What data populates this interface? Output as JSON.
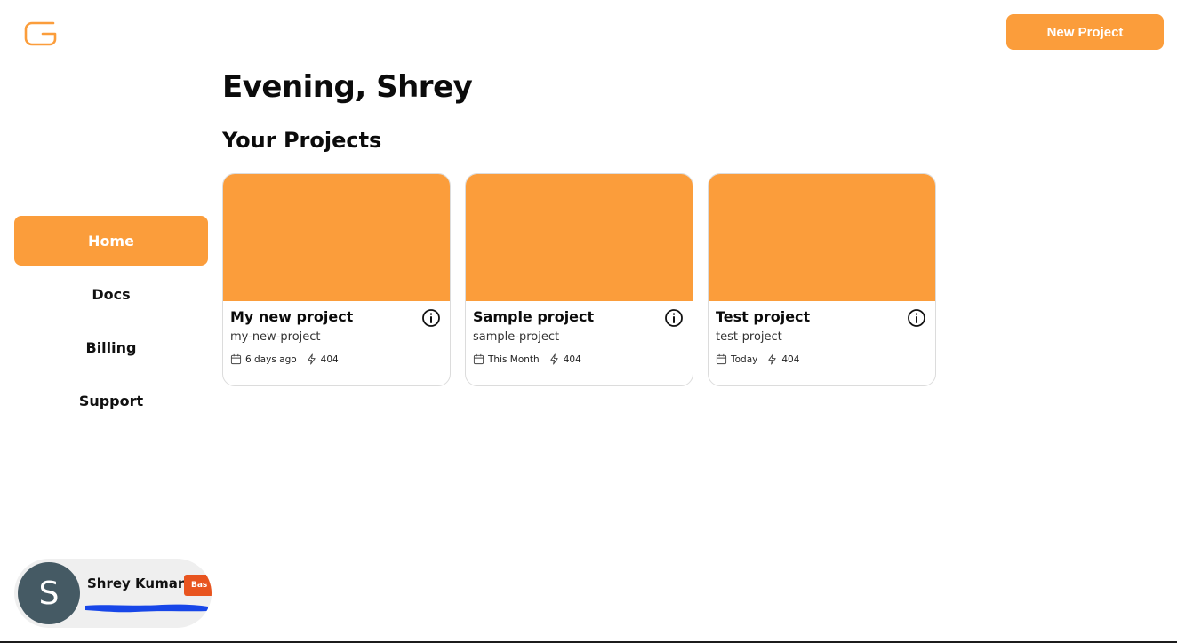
{
  "app": {
    "logo_icon": "g-logo-icon",
    "brand_color": "#fb9d3b"
  },
  "header": {
    "new_project_label": "New Project"
  },
  "sidebar": {
    "items": [
      {
        "label": "Home",
        "active": true
      },
      {
        "label": "Docs",
        "active": false
      },
      {
        "label": "Billing",
        "active": false
      },
      {
        "label": "Support",
        "active": false
      }
    ]
  },
  "user": {
    "avatar_initial": "S",
    "name": "Shrey Kumar",
    "plan_badge": "Bas",
    "avatar_color": "#455a64",
    "badge_color": "#e8541f"
  },
  "main": {
    "greeting": "Evening, Shrey",
    "section_title": "Your Projects",
    "projects": [
      {
        "title": "My new project",
        "slug": "my-new-project",
        "date": "6 days ago",
        "status": "404"
      },
      {
        "title": "Sample project",
        "slug": "sample-project",
        "date": "This Month",
        "status": "404"
      },
      {
        "title": "Test project",
        "slug": "test-project",
        "date": "Today",
        "status": "404"
      }
    ]
  }
}
